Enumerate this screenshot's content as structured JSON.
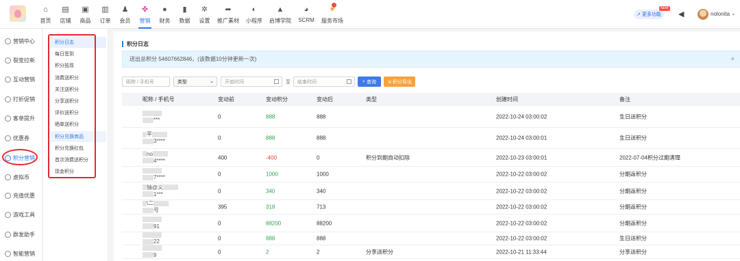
{
  "topnav": {
    "items": [
      {
        "label": "首页",
        "icon": "home-icon",
        "glyph": "⌂"
      },
      {
        "label": "店铺",
        "icon": "store-icon",
        "glyph": "▤"
      },
      {
        "label": "商品",
        "icon": "goods-icon",
        "glyph": "▣"
      },
      {
        "label": "订单",
        "icon": "order-icon",
        "glyph": "▥"
      },
      {
        "label": "会员",
        "icon": "member-icon",
        "glyph": "♟"
      },
      {
        "label": "营销",
        "icon": "marketing-icon",
        "glyph": "✤"
      },
      {
        "label": "财务",
        "icon": "finance-icon",
        "glyph": "●"
      },
      {
        "label": "数据",
        "icon": "data-icon",
        "glyph": "▮"
      },
      {
        "label": "设置",
        "icon": "settings-icon",
        "glyph": "✲"
      },
      {
        "label": "推广素材",
        "icon": "share-icon",
        "glyph": "➦"
      },
      {
        "label": "小程序",
        "icon": "miniapp-icon",
        "glyph": "◐"
      },
      {
        "label": "启博学院",
        "icon": "academy-icon",
        "glyph": "▲"
      },
      {
        "label": "SCRM",
        "icon": "scrm-icon",
        "glyph": "◕"
      },
      {
        "label": "服务市场",
        "icon": "market-icon",
        "glyph": "♥"
      }
    ],
    "more_label": "更多功能",
    "new_tag": "NEW",
    "username": "nolonita"
  },
  "sidebar1": [
    {
      "label": "营销中心",
      "glyph": "◎"
    },
    {
      "label": "裂变拉新",
      "glyph": "◎"
    },
    {
      "label": "互动营销",
      "glyph": "◎"
    },
    {
      "label": "打折促销",
      "glyph": "◎"
    },
    {
      "label": "客单提升",
      "glyph": "◎"
    },
    {
      "label": "优惠券",
      "glyph": "◎"
    },
    {
      "label": "积分营销",
      "glyph": "◎"
    },
    {
      "label": "虚拟币",
      "glyph": "◎"
    },
    {
      "label": "充值优惠",
      "glyph": "◎"
    },
    {
      "label": "游戏工具",
      "glyph": "◎"
    },
    {
      "label": "群发助手",
      "glyph": "◎"
    },
    {
      "label": "智能营销",
      "glyph": "◎"
    }
  ],
  "sidebar2": [
    "积分日志",
    "每日签到",
    "积分抵现",
    "消费送积分",
    "关注送积分",
    "分享送积分",
    "评价送积分",
    "晒单送积分",
    "积分兑换商品",
    "积分兑换红包",
    "首次消费送积分",
    "现金积分"
  ],
  "main": {
    "title": "积分日志",
    "notice": "送出总积分 54607662846，(该数据10分钟更新一次)",
    "notice_close": "×",
    "filters": {
      "nick_placeholder": "昵称 / 手机号",
      "type_value": "类型",
      "start_placeholder": "开始时间",
      "to_label": "至",
      "end_placeholder": "结束时间",
      "query_label": "查询",
      "export_label": "积分导出"
    },
    "columns": [
      "昵称 / 手机号",
      "变动前",
      "变动积分",
      "变动后",
      "类型",
      "创建时间",
      "备注"
    ],
    "rows": [
      {
        "nick1": "",
        "nick2": "***",
        "before": "0",
        "change": "888",
        "sign": "pos",
        "after": "888",
        "type": "",
        "time": "2022-10-24 03:00:02",
        "note": "生日送积分"
      },
      {
        "nick1": "平",
        "nick2": "3****",
        "before": "0",
        "change": "888",
        "sign": "pos",
        "after": "888",
        "type": "",
        "time": "2022-10-24 03:00:01",
        "note": "生日送积分"
      },
      {
        "nick1": "no",
        "nick2": "4****",
        "before": "400",
        "change": "-400",
        "sign": "neg",
        "after": "0",
        "type": "积分到期自动扣除",
        "time": "2022-10-23 03:00:01",
        "note": "2022-07-04积分过期清理"
      },
      {
        "nick1": "",
        "nick2": "7****",
        "before": "0",
        "change": "1000",
        "sign": "pos",
        "after": "1000",
        "type": "",
        "time": "2022-10-22 03:00:02",
        "note": "分期返积分"
      },
      {
        "nick1": "铀@义",
        "nick2": "1***",
        "before": "0",
        "change": "340",
        "sign": "pos",
        "after": "340",
        "type": "",
        "time": "2022-10-22 03:00:02",
        "note": "分期返积分"
      },
      {
        "nick1": "\\二",
        "nick2": "号",
        "before": "395",
        "change": "318",
        "sign": "pos",
        "after": "713",
        "type": "",
        "time": "2022-10-22 03:00:02",
        "note": "分期返积分"
      },
      {
        "nick1": "",
        "nick2": "91",
        "before": "0",
        "change": "88200",
        "sign": "pos",
        "after": "88200",
        "type": "",
        "time": "2022-10-22 03:00:02",
        "note": "分期返积分"
      },
      {
        "nick1": "",
        "nick2": "22",
        "before": "0",
        "change": "888",
        "sign": "pos",
        "after": "888",
        "type": "",
        "time": "2022-10-22 03:00:02",
        "note": "生日送积分"
      },
      {
        "nick1": "",
        "nick2": "9",
        "before": "0",
        "change": "2",
        "sign": "pos",
        "after": "2",
        "type": "分享送积分",
        "time": "2022-10-21 11:33:44",
        "note": "分享送积分"
      }
    ]
  },
  "colors": {
    "accent": "#2d7be5",
    "positive": "#2da44e",
    "negative": "#e5383b",
    "export": "#f7a23b",
    "annotation": "#e4262b"
  }
}
